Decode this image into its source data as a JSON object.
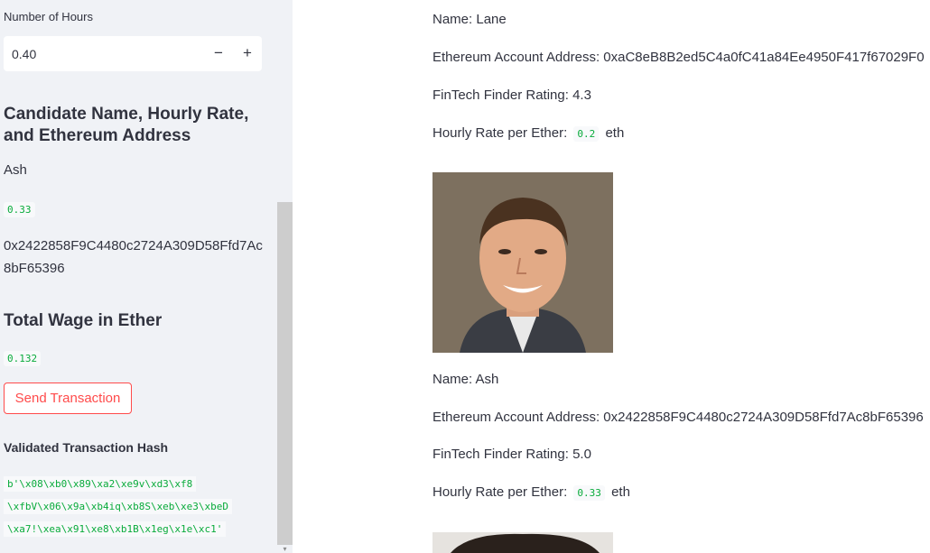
{
  "sidebar": {
    "hours_label": "Number of Hours",
    "hours_value": "0.40",
    "minus_label": "−",
    "plus_label": "+",
    "candidate_heading": "Candidate Name, Hourly Rate, and Ethereum Address",
    "candidate_name": "Ash",
    "candidate_rate": "0.33",
    "candidate_address": "0x2422858F9C4480c2724A309D58Ffd7Ac8bF65396",
    "wage_heading": "Total Wage in Ether",
    "wage_value": "0.132",
    "send_button": "Send Transaction",
    "hash_heading": "Validated Transaction Hash",
    "hash_lines": [
      "b'\\x08\\xb0\\x89\\xa2\\xe9v\\xd3\\xf8",
      "\\xfbV\\x06\\x9a\\xb4iq\\xb8S\\xeb\\xe3\\xbeD",
      "\\xa7!\\xea\\x91\\xe8\\xb1B\\x1eg\\x1e\\xc1'"
    ]
  },
  "main": {
    "cut_name": "Name: Lane",
    "candidates": [
      {
        "address_label": "Ethereum Account Address:",
        "address": "0xaC8eB8B2ed5C4a0fC41a84Ee4950F417f67029F0",
        "rating_label": "FinTech Finder Rating:",
        "rating": "4.3",
        "rate_label": "Hourly Rate per Ether:",
        "rate": "0.2",
        "unit": "eth"
      },
      {
        "name_label": "Name: Ash",
        "address_label": "Ethereum Account Address:",
        "address": "0x2422858F9C4480c2724A309D58Ffd7Ac8bF65396",
        "rating_label": "FinTech Finder Rating:",
        "rating": "5.0",
        "rate_label": "Hourly Rate per Ether:",
        "rate": "0.33",
        "unit": "eth"
      }
    ]
  },
  "colors": {
    "sidebar_bg": "#f0f2f6",
    "accent": "#ff4b4b",
    "code_green": "#09ab3b",
    "text": "#31333f"
  }
}
